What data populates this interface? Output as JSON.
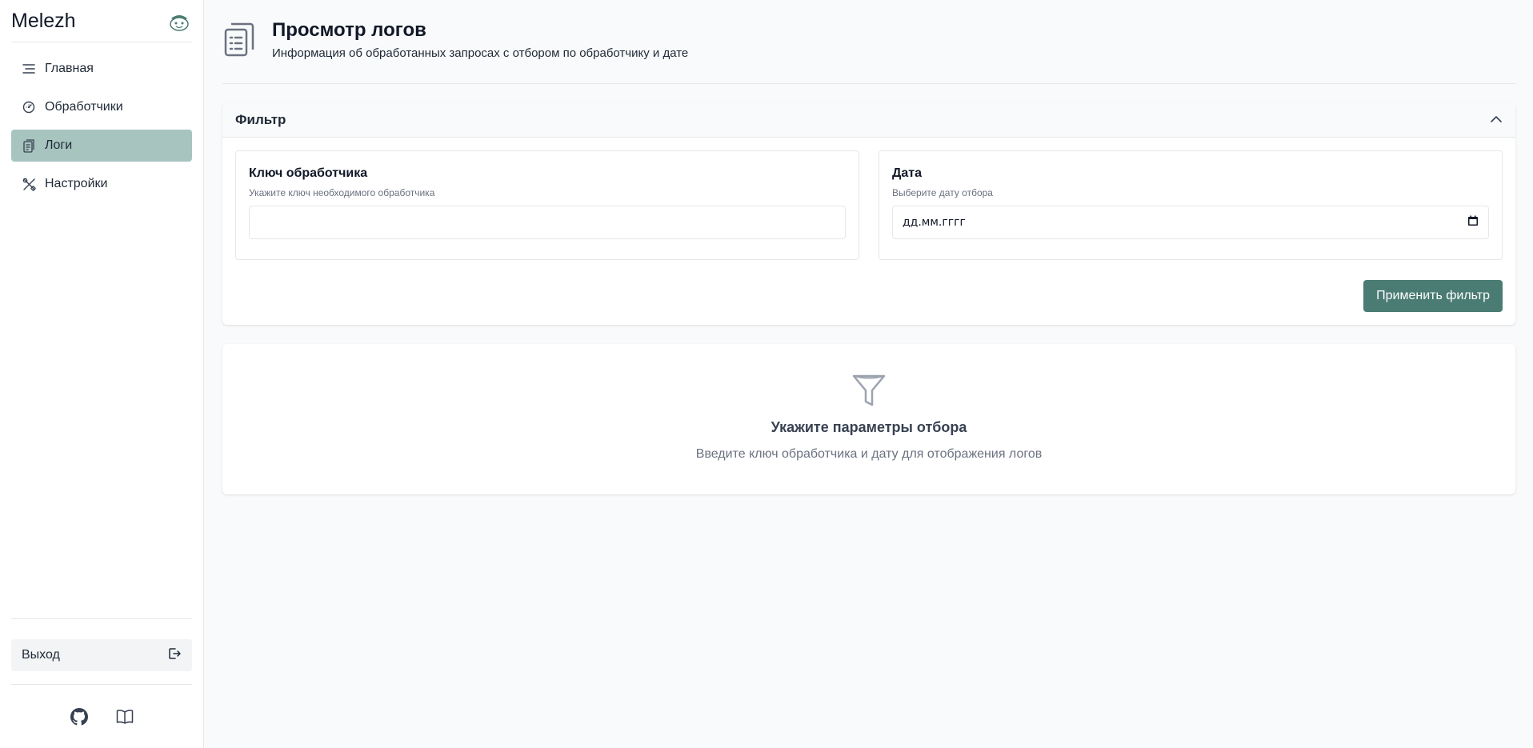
{
  "brand": {
    "title": "Melezh"
  },
  "nav": {
    "items": [
      {
        "label": "Главная"
      },
      {
        "label": "Обработчики"
      },
      {
        "label": "Логи"
      },
      {
        "label": "Настройки"
      }
    ],
    "active_index": 2
  },
  "logout": {
    "label": "Выход"
  },
  "header": {
    "title": "Просмотр логов",
    "subtitle": "Информация об обработанных запросах с отбором по обработчику и дате"
  },
  "filter": {
    "title": "Фильтр",
    "handler_key": {
      "label": "Ключ обработчика",
      "hint": "Укажите ключ необходимого обработчика",
      "value": ""
    },
    "date": {
      "label": "Дата",
      "hint": "Выберите дату отбора",
      "placeholder": "дд.мм.гггг"
    },
    "apply_label": "Применить фильтр"
  },
  "empty_state": {
    "title": "Укажите параметры отбора",
    "text": "Введите ключ обработчика и дату для отображения логов"
  },
  "colors": {
    "accent": "#4a7c73",
    "active_nav": "#a7c4bf"
  },
  "icons": {
    "nav": [
      "menu-lines-icon",
      "dashboard-gauge-icon",
      "clipboard-icon",
      "tools-icon"
    ],
    "logout": "logout-icon",
    "footer": [
      "github-icon",
      "book-icon"
    ],
    "header": "clipboard-list-icon",
    "empty": "filter-funnel-icon"
  }
}
